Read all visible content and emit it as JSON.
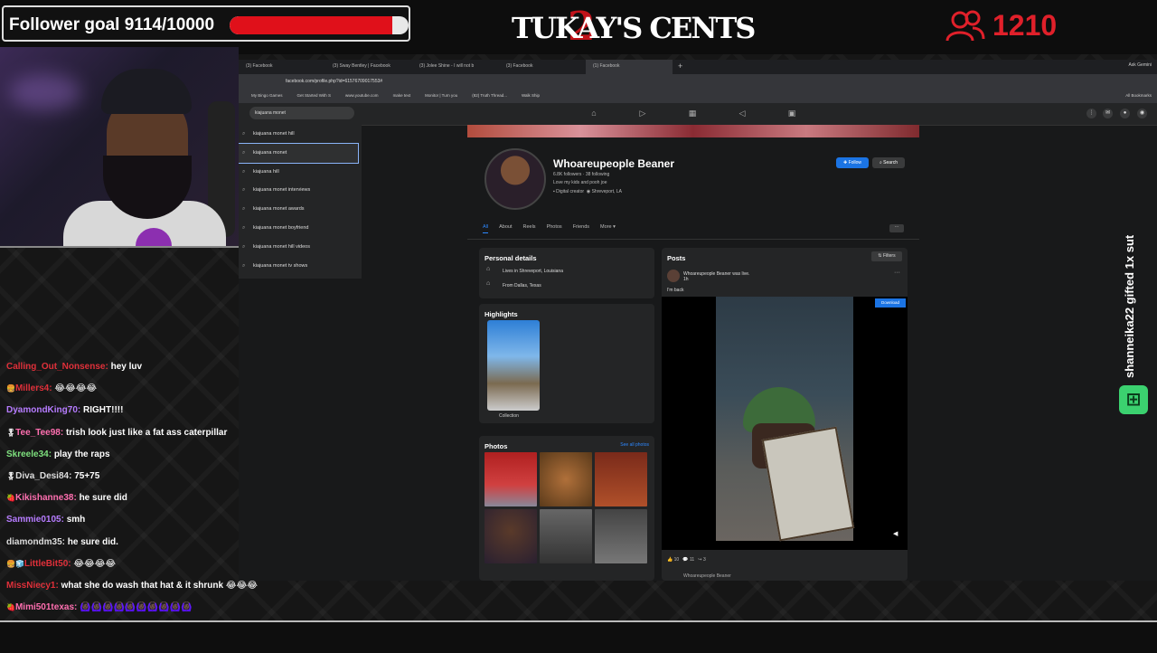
{
  "overlay": {
    "follower_goal": "Follower goal 9114/10000",
    "goal_current": 9114,
    "goal_target": 10000,
    "brand": "TUKAY'S CENTS",
    "brand_number": "2",
    "viewer_count": "1210",
    "gift_text": "shanneika22 gifted 1x sut",
    "colors": {
      "accent_red": "#e0101a",
      "fb_blue": "#1b74e4",
      "gift_green": "#3bd16f"
    }
  },
  "browser": {
    "tabs": [
      "(3) Facebook",
      "(3) Sway Bentley | Facebook",
      "(3) Jolee Shine - I will not b",
      "(3) Facebook",
      "(1) Facebook"
    ],
    "ask_gemini": "Ask Gemini",
    "url": "facebook.com/profile.php?id=61576709017553#",
    "bookmarks": [
      "My Bingo Games",
      "Get Started With S",
      "www.youtube.com",
      "make text",
      "Monitor | Turn you",
      "(82) Truth Thread...",
      "Walk Ship"
    ],
    "all_bookmarks": "All Bookmarks"
  },
  "fb": {
    "search_value": "kiajuana monet",
    "suggestions": [
      "kiajuana monet hill",
      "kiajuana monet",
      "kiajuana hill",
      "kiajuana monet interviews",
      "kiajuana monet awards",
      "kiajuana monet boyfriend",
      "kiajuana monet hill videos",
      "kiajuana monet tv shows"
    ],
    "profile": {
      "name": "Whoareupeople Beaner",
      "followers": "6.8K followers · 38 following",
      "bio": "Love my kids and pooh joe",
      "meta_creator": "Digital creator",
      "meta_location": "Shreveport, LA",
      "follow_label": "Follow",
      "search_label": "Search"
    },
    "tabs": [
      "All",
      "About",
      "Reels",
      "Photos",
      "Friends",
      "More ▾"
    ],
    "personal_details": {
      "title": "Personal details",
      "lives": "Lives in Shreveport, Louisiana",
      "from": "From Dallas, Texas"
    },
    "highlights": {
      "title": "Highlights",
      "label": "Collection"
    },
    "photos": {
      "title": "Photos",
      "see_all": "See all photos"
    },
    "posts": {
      "title": "Posts",
      "filters": "Filters",
      "author": "Whoareupeople Beaner",
      "author_suffix": "was live.",
      "time": "1h",
      "text": "I'm back",
      "download": "Download",
      "reactions": "10",
      "comments": "11",
      "shares": "3",
      "next_author": "Whoareupeople Beaner"
    }
  },
  "chat": [
    {
      "name": "Calling_Out_Nonsense:",
      "msg": "hey luv",
      "color": "#e0303a",
      "badge": ""
    },
    {
      "name": "Millers4:",
      "msg": "😂😂😂😂",
      "color": "#e0303a",
      "badge": "🍔"
    },
    {
      "name": "DyamondKing70:",
      "msg": "RIGHT!!!!",
      "color": "#b67cff",
      "badge": ""
    },
    {
      "name": "Tee_Tee98:",
      "msg": "trish look just like a fat ass caterpillar",
      "color": "#ff6fb0",
      "badge": "🎖"
    },
    {
      "name": "Skreele34:",
      "msg": "play the raps",
      "color": "#7ee07e",
      "badge": ""
    },
    {
      "name": "Diva_Desi84:",
      "msg": "75+75",
      "color": "#ddd",
      "badge": "🎖"
    },
    {
      "name": "Kikishanne38:",
      "msg": "he sure did",
      "color": "#ff6fb0",
      "badge": "🍓"
    },
    {
      "name": "Sammie0105:",
      "msg": "smh",
      "color": "#b67cff",
      "badge": ""
    },
    {
      "name": "diamondm35:",
      "msg": "he sure did.",
      "color": "#ddd",
      "badge": ""
    },
    {
      "name": "LittleBit50:",
      "msg": "😂😂😂😂",
      "color": "#e0303a",
      "badge": "🍔🧊"
    },
    {
      "name": "MissNiecy1:",
      "msg": "what she do wash that hat & it shrunk 😂😂😂",
      "color": "#e0303a",
      "badge": ""
    },
    {
      "name": "Mimi501texas:",
      "msg": "🙆🏿‍♀️🙆🏿‍♀️🙆🏿‍♀️🙆🏿‍♀️🙆🏿‍♀️🙆🏿‍♀️🙆🏿‍♀️🙆🏿‍♀️🙆🏿‍♀️🙆🏿‍♀️",
      "color": "#ff6fb0",
      "badge": "🍓"
    }
  ]
}
